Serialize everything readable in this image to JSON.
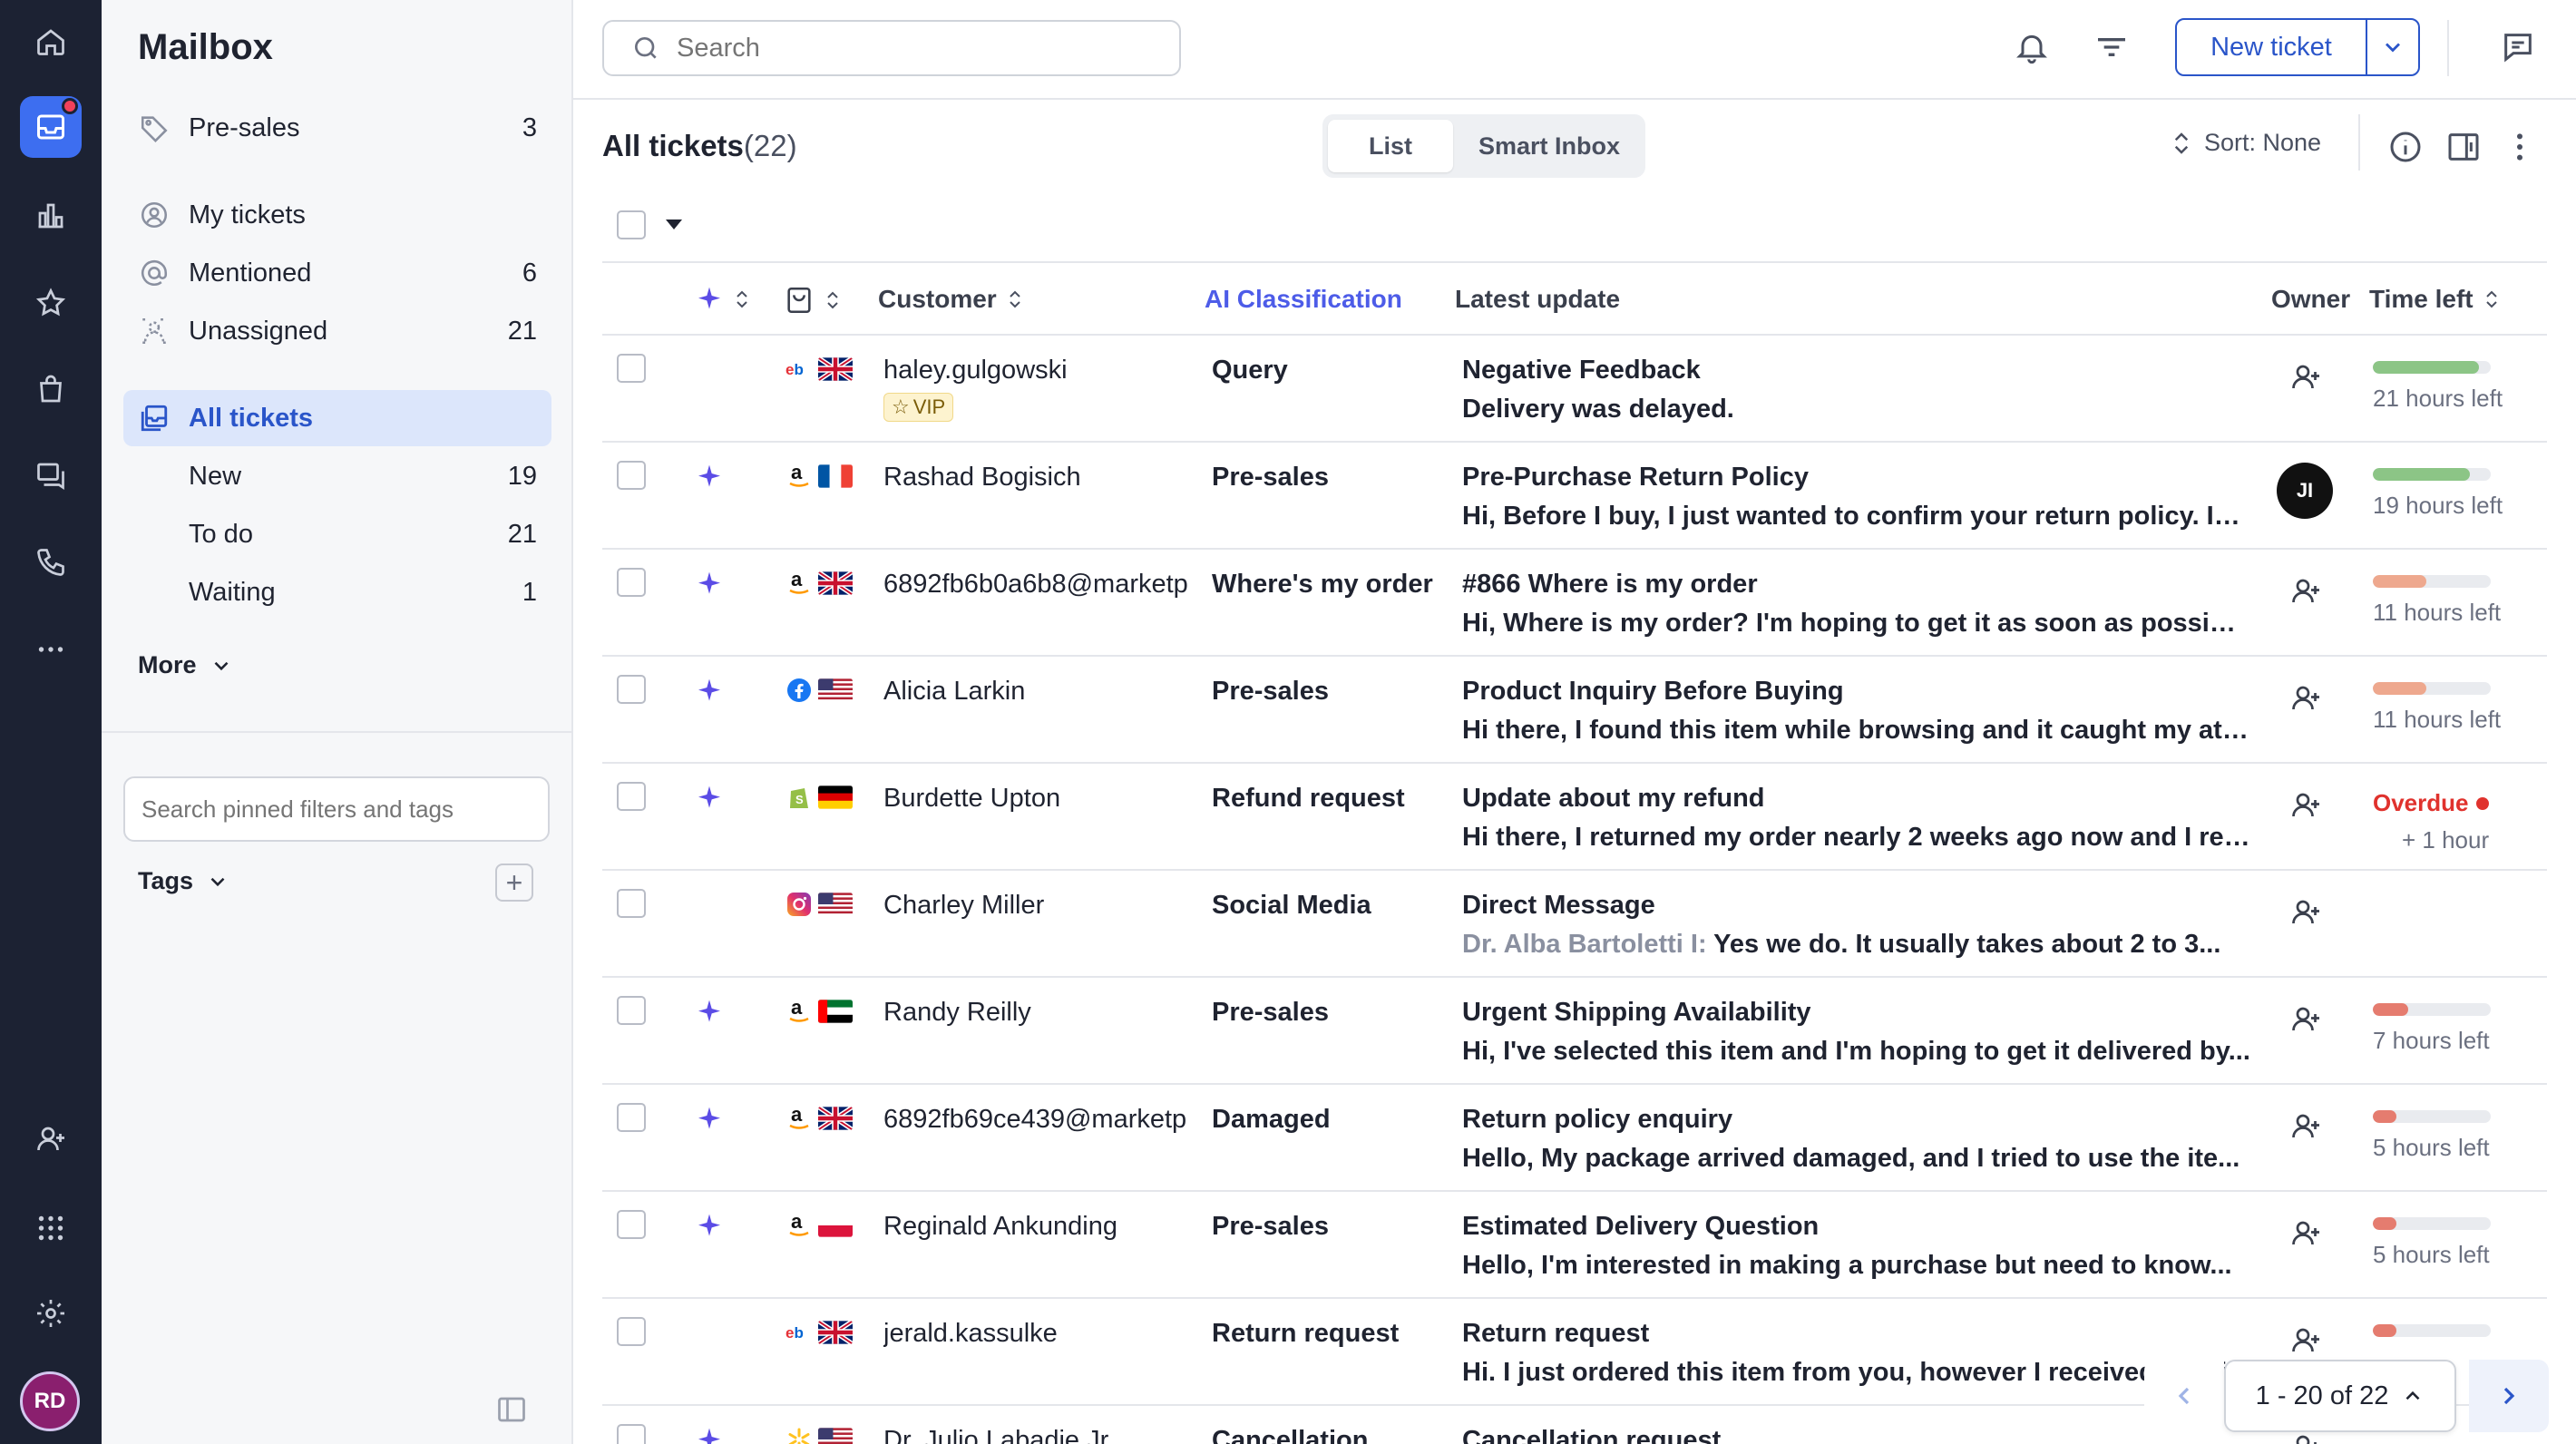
{
  "colors": {
    "accent": "#2a55c9",
    "rail_bg": "#1c2233",
    "ai_label": "#4d5ce8",
    "overdue": "#e0322d",
    "bar_green": "#8cc586",
    "bar_orange": "#eea88e",
    "bar_red": "#e57c6f"
  },
  "rail": {
    "items": [
      {
        "name": "home-icon"
      },
      {
        "name": "inbox-icon",
        "active": true,
        "has_notification": true
      },
      {
        "name": "chart-icon"
      },
      {
        "name": "star-icon"
      },
      {
        "name": "bag-icon"
      },
      {
        "name": "chat-icon"
      },
      {
        "name": "phone-icon"
      },
      {
        "name": "more-icon"
      }
    ],
    "bottom": [
      {
        "name": "add-user-icon"
      },
      {
        "name": "apps-grid-icon"
      },
      {
        "name": "settings-icon"
      }
    ],
    "avatar_initials": "RD"
  },
  "sidebar": {
    "title": "Mailbox",
    "items": [
      {
        "label": "Pre-sales",
        "count": "3",
        "icon": "tag-icon"
      },
      {
        "label": "My tickets",
        "count": "",
        "icon": "user-circle-icon"
      },
      {
        "label": "Mentioned",
        "count": "6",
        "icon": "at-icon"
      },
      {
        "label": "Unassigned",
        "count": "21",
        "icon": "unassigned-icon"
      },
      {
        "label": "All tickets",
        "count": "",
        "icon": "inbox-stack-icon",
        "active": true
      }
    ],
    "subitems": [
      {
        "label": "New",
        "count": "19"
      },
      {
        "label": "To do",
        "count": "21"
      },
      {
        "label": "Waiting",
        "count": "1"
      }
    ],
    "more_label": "More",
    "search_placeholder": "Search pinned filters and tags",
    "tags_label": "Tags"
  },
  "topbar": {
    "search_placeholder": "Search",
    "new_ticket_label": "New ticket"
  },
  "view": {
    "title": "All tickets",
    "count": "(22)",
    "tabs": [
      "List",
      "Smart Inbox"
    ],
    "active_tab": "List",
    "sort_label": "Sort: None"
  },
  "table": {
    "headers": {
      "customer": "Customer",
      "ai": "AI Classification",
      "latest": "Latest update",
      "owner": "Owner",
      "time": "Time left"
    },
    "rows": [
      {
        "ai_spark": false,
        "marketplace": "ebay",
        "flag": "gb",
        "customer": "haley.gulgowski",
        "vip": "VIP",
        "classification": "Query",
        "subject": "Negative Feedback",
        "agent": "",
        "message": "Delivery was delayed.",
        "owner": "",
        "progress": 0.9,
        "bar": "green",
        "time": "21 hours left",
        "overdue": false
      },
      {
        "ai_spark": true,
        "marketplace": "amazon",
        "flag": "fr",
        "customer": "Rashad Bogisich",
        "vip": "",
        "classification": "Pre-sales",
        "subject": "Pre-Purchase Return Policy",
        "agent": "",
        "message": "Hi, Before I buy, I just wanted to confirm your return policy. In...",
        "owner": "JI",
        "progress": 0.82,
        "bar": "green",
        "time": "19 hours left",
        "overdue": false
      },
      {
        "ai_spark": true,
        "marketplace": "amazon",
        "flag": "gb",
        "customer": "6892fb6b0a6b8@marketp",
        "vip": "",
        "classification": "Where's my order",
        "subject": "#866 Where is my order",
        "agent": "",
        "message": "Hi, Where is my order? I'm hoping to get it as soon as possible...",
        "owner": "",
        "progress": 0.45,
        "bar": "orange",
        "time": "11 hours left",
        "overdue": false
      },
      {
        "ai_spark": true,
        "marketplace": "facebook",
        "flag": "us",
        "customer": "Alicia Larkin",
        "vip": "",
        "classification": "Pre-sales",
        "subject": "Product Inquiry Before Buying",
        "agent": "",
        "message": "Hi there, I found this item while browsing and it caught my at-...",
        "owner": "",
        "progress": 0.45,
        "bar": "orange",
        "time": "11 hours left",
        "overdue": false
      },
      {
        "ai_spark": true,
        "marketplace": "shopify",
        "flag": "de",
        "customer": "Burdette Upton",
        "vip": "",
        "classification": "Refund request",
        "subject": "Update about my refund",
        "agent": "",
        "message": "Hi there, I returned my order nearly 2 weeks ago now and I re-...",
        "owner": "",
        "progress": 0,
        "bar": "none",
        "time": "Overdue",
        "overdue_extra": "+ 1 hour",
        "overdue": true
      },
      {
        "ai_spark": false,
        "marketplace": "instagram",
        "flag": "us",
        "customer": "Charley Miller",
        "vip": "",
        "classification": "Social Media",
        "subject": "Direct Message",
        "agent": "Dr. Alba Bartoletti I:",
        "message": "Yes we do. It usually takes about 2 to 3...",
        "owner": "",
        "progress": 0,
        "bar": "none",
        "time": "",
        "overdue": false
      },
      {
        "ai_spark": true,
        "marketplace": "amazon",
        "flag": "ae",
        "customer": "Randy Reilly",
        "vip": "",
        "classification": "Pre-sales",
        "subject": "Urgent Shipping Availability",
        "agent": "",
        "message": "Hi, I've selected this item and I'm hoping to get it delivered by...",
        "owner": "",
        "progress": 0.3,
        "bar": "red",
        "time": "7 hours left",
        "overdue": false
      },
      {
        "ai_spark": true,
        "marketplace": "amazon",
        "flag": "gb",
        "customer": "6892fb69ce439@marketp",
        "vip": "",
        "classification": "Damaged",
        "subject": "Return policy enquiry",
        "agent": "",
        "message": "Hello, My package arrived damaged, and I tried to use the ite...",
        "owner": "",
        "progress": 0.2,
        "bar": "red",
        "time": "5 hours left",
        "overdue": false
      },
      {
        "ai_spark": true,
        "marketplace": "amazon",
        "flag": "pl",
        "customer": "Reginald Ankunding",
        "vip": "",
        "classification": "Pre-sales",
        "subject": "Estimated Delivery Question",
        "agent": "",
        "message": "Hello, I'm interested in making a purchase but need to know...",
        "owner": "",
        "progress": 0.2,
        "bar": "red",
        "time": "5 hours left",
        "overdue": false
      },
      {
        "ai_spark": false,
        "marketplace": "ebay",
        "flag": "gb",
        "customer": "jerald.kassulke",
        "vip": "",
        "classification": "Return request",
        "subject": "Return request",
        "agent": "",
        "message": "Hi. I just ordered this item from you, however I received a diffe",
        "owner": "",
        "progress": 0.2,
        "bar": "red",
        "time": "",
        "overdue": false
      },
      {
        "ai_spark": true,
        "marketplace": "walmart",
        "flag": "us",
        "customer": "Dr. Julio Labadie Jr.",
        "vip": "",
        "classification": "Cancellation",
        "subject": "Cancellation request",
        "agent": "",
        "message": "",
        "owner": "",
        "progress": 0,
        "bar": "none",
        "time": "",
        "overdue": false
      }
    ]
  },
  "pagination": {
    "label": "1 - 20 of 22"
  }
}
